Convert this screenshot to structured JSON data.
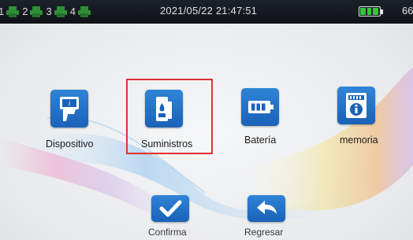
{
  "status_bar": {
    "slots": [
      {
        "number": "1",
        "color": "#2f8f37"
      },
      {
        "number": "2",
        "color": "#2f8f37"
      },
      {
        "number": "3",
        "color": "#2f8f37"
      },
      {
        "number": "4",
        "color": "#2f8f37"
      }
    ],
    "datetime": "2021/05/22 21:47:51",
    "battery_level": 1.0,
    "battery_color": "#39c33b",
    "battery_percent_text": "66"
  },
  "menu": {
    "items": [
      {
        "label": "Dispositivo",
        "icon": "device-info-icon"
      },
      {
        "label": "Suministros",
        "icon": "ink-cartridge-icon",
        "selected": true
      },
      {
        "label": "Batería",
        "icon": "battery-icon"
      },
      {
        "label": "memoria",
        "icon": "memory-card-info-icon"
      }
    ]
  },
  "actions": {
    "confirm_label": "Confirma",
    "back_label": "Regresar"
  },
  "colors": {
    "tile_blue": "#1f6fc5",
    "selection_red": "#e03131"
  }
}
